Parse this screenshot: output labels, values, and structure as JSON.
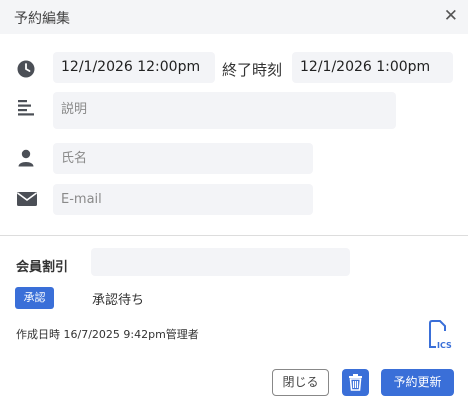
{
  "dialog": {
    "title": "予約編集",
    "close_symbol": "✕"
  },
  "schedule": {
    "icon": "clock-icon",
    "start_value": "12/1/2026 12:00pm",
    "end_label": "終了時刻",
    "end_value": "12/1/2026 1:00pm"
  },
  "description": {
    "icon": "align-left-icon",
    "placeholder": "説明"
  },
  "name": {
    "icon": "user-icon",
    "placeholder": "氏名"
  },
  "email": {
    "icon": "envelope-icon",
    "placeholder": "E-mail"
  },
  "discount": {
    "label": "会員割引",
    "value": ""
  },
  "status": {
    "badge": "承認",
    "text": "承認待ち"
  },
  "created": {
    "text": "作成日時 16/7/2025 9:42pm管理者"
  },
  "ics": {
    "icon": "ics-file-icon",
    "label": "ICS"
  },
  "footer": {
    "close_label": "閉じる",
    "delete_icon": "trash-icon",
    "update_label": "予約更新"
  },
  "colors": {
    "primary": "#3a6fd8",
    "field_bg": "#f3f4f7",
    "icon": "#4b4f56"
  }
}
